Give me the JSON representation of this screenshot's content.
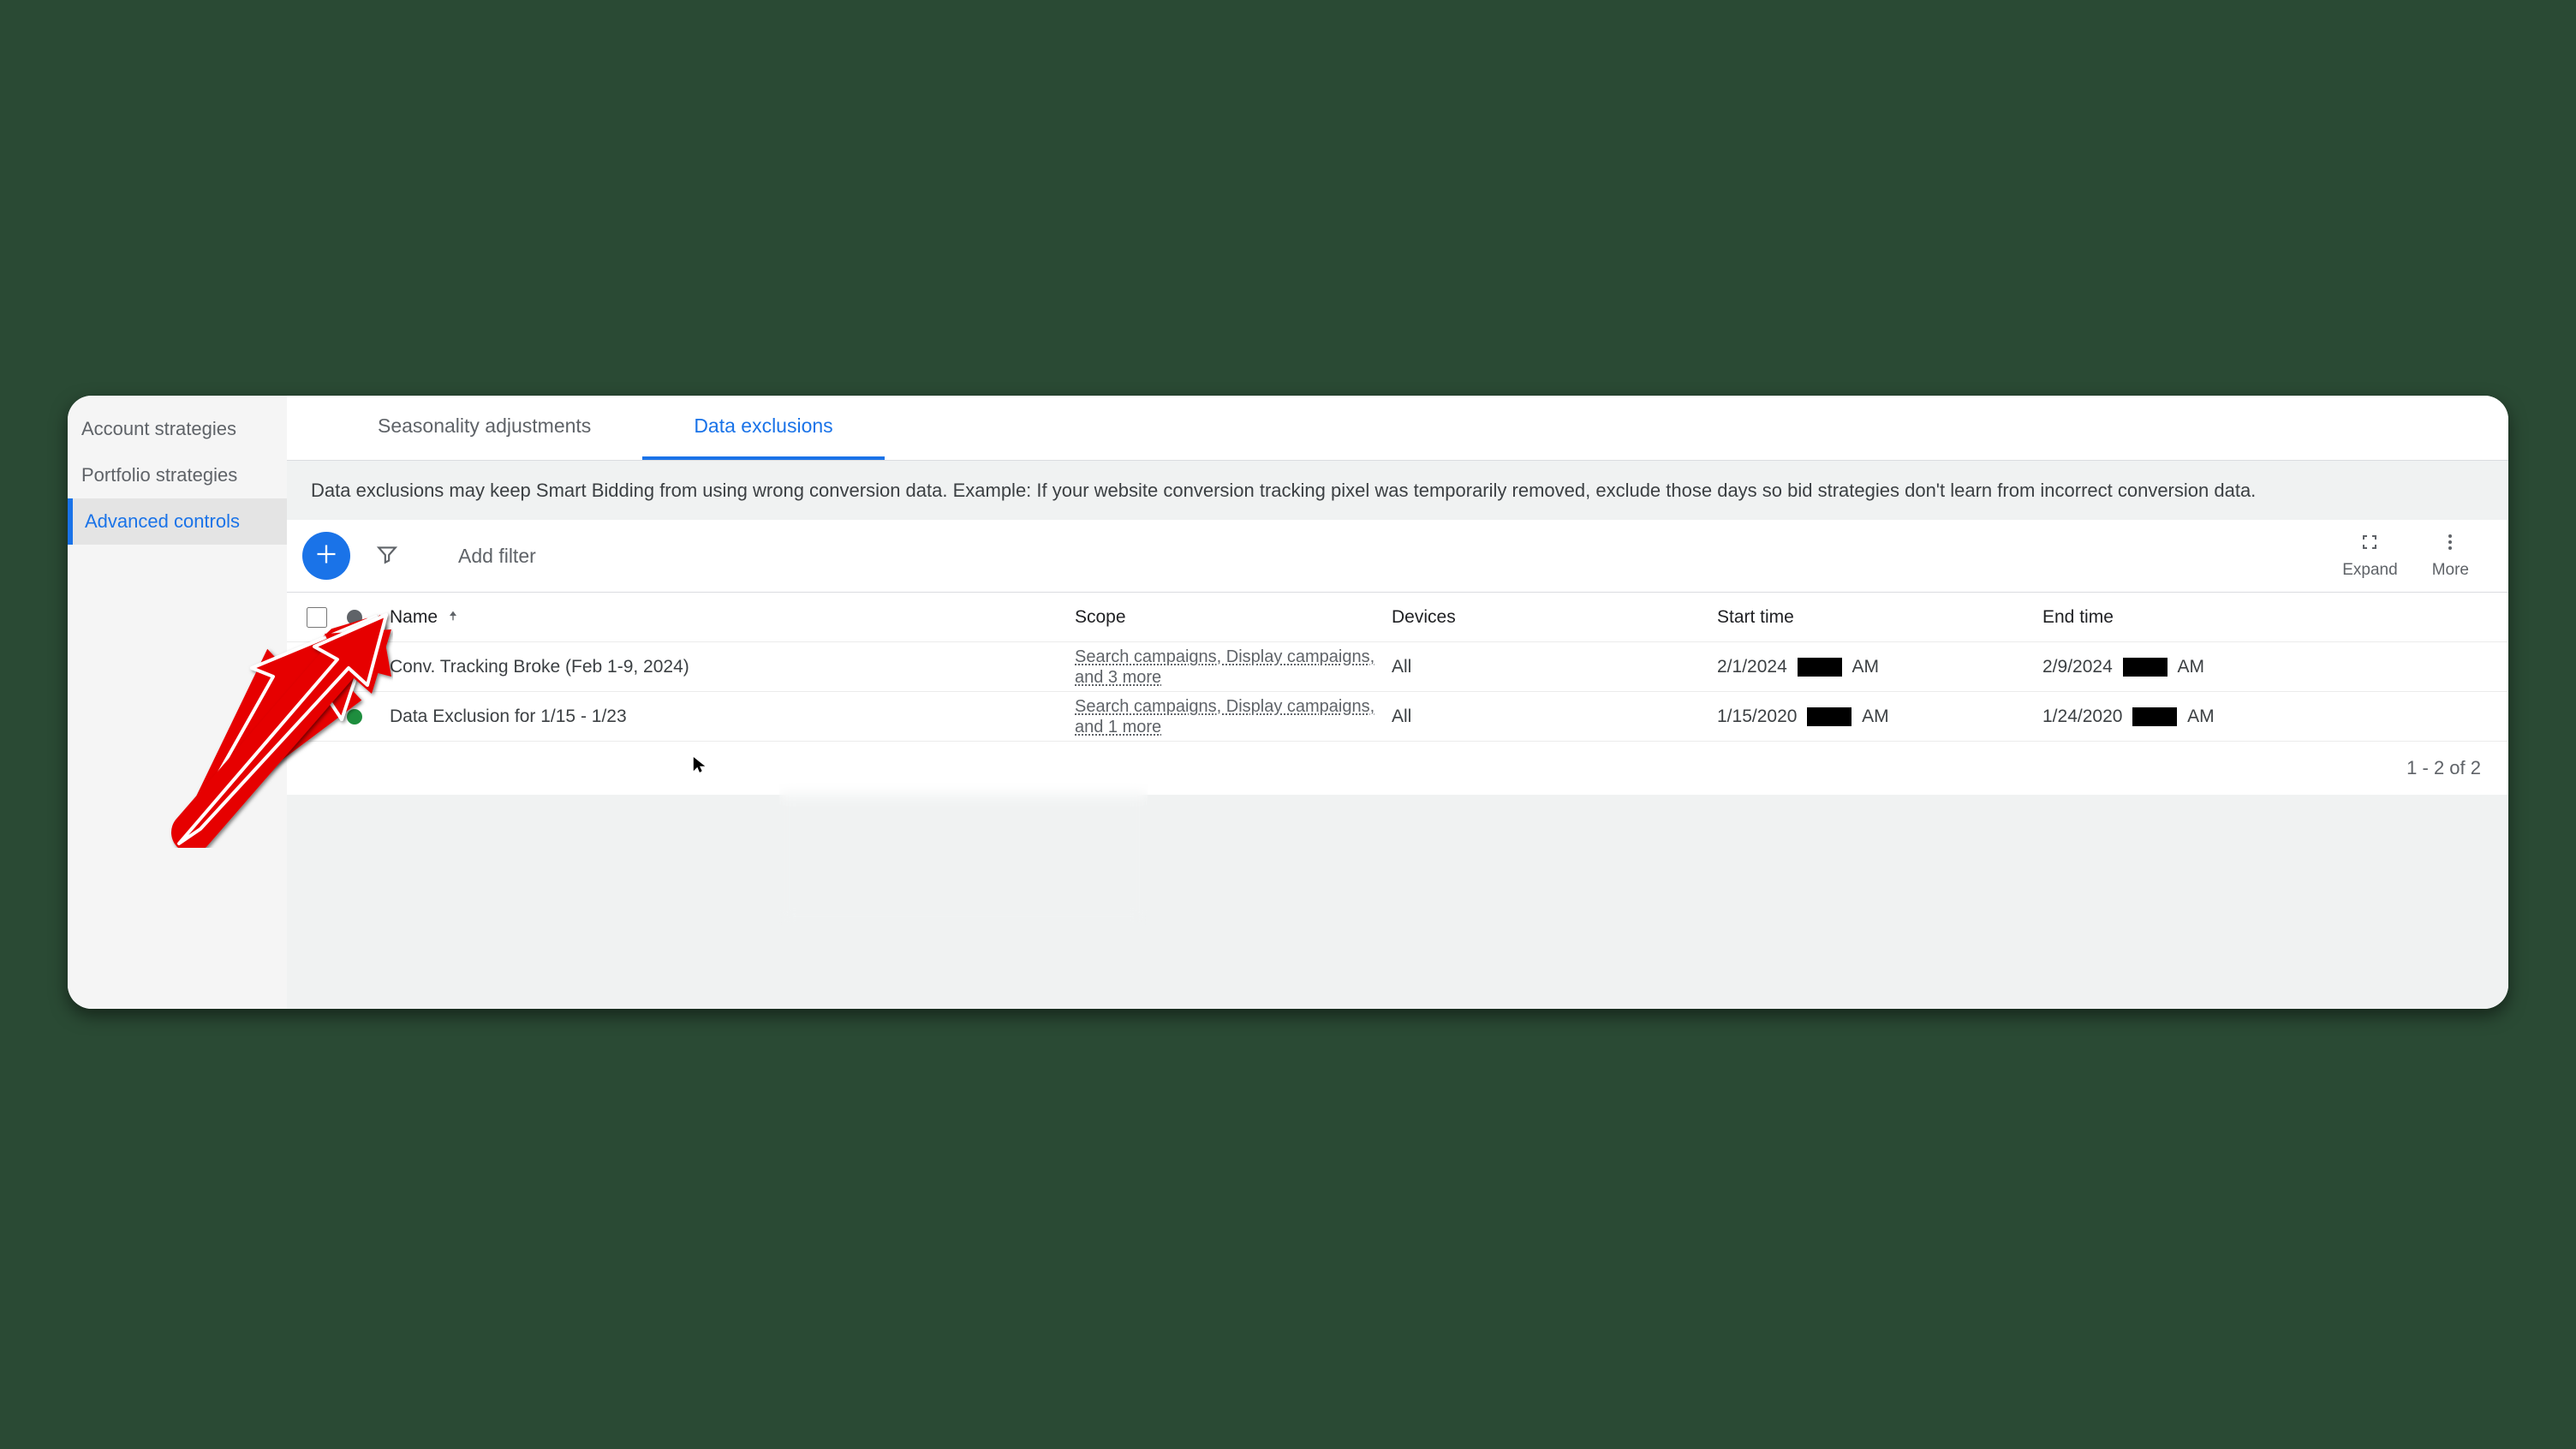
{
  "sidebar": {
    "items": [
      {
        "label": "Account strategies"
      },
      {
        "label": "Portfolio strategies"
      },
      {
        "label": "Advanced controls"
      }
    ]
  },
  "tabs": {
    "seasonality": "Seasonality adjustments",
    "data_exclusions": "Data exclusions"
  },
  "description": "Data exclusions may keep Smart Bidding from using wrong conversion data. Example: If your website conversion tracking pixel was temporarily removed, exclude those days so bid strategies don't learn from incorrect conversion data.",
  "toolbar": {
    "add_filter": "Add filter",
    "expand": "Expand",
    "more": "More"
  },
  "table": {
    "headers": {
      "name": "Name",
      "scope": "Scope",
      "devices": "Devices",
      "start_time": "Start time",
      "end_time": "End time"
    },
    "rows": [
      {
        "name": "Conv. Tracking Broke (Feb 1-9, 2024)",
        "scope": "Search campaigns, Display campaigns, and 3 more",
        "devices": "All",
        "start_date": "2/1/2024",
        "start_suffix": "AM",
        "end_date": "2/9/2024",
        "end_suffix": "AM"
      },
      {
        "name": "Data Exclusion for 1/15 - 1/23",
        "scope": "Search campaigns, Display campaigns, and 1 more",
        "devices": "All",
        "start_date": "1/15/2020",
        "start_suffix": "AM",
        "end_date": "1/24/2020",
        "end_suffix": "AM"
      }
    ]
  },
  "pagination": "1 - 2 of 2"
}
